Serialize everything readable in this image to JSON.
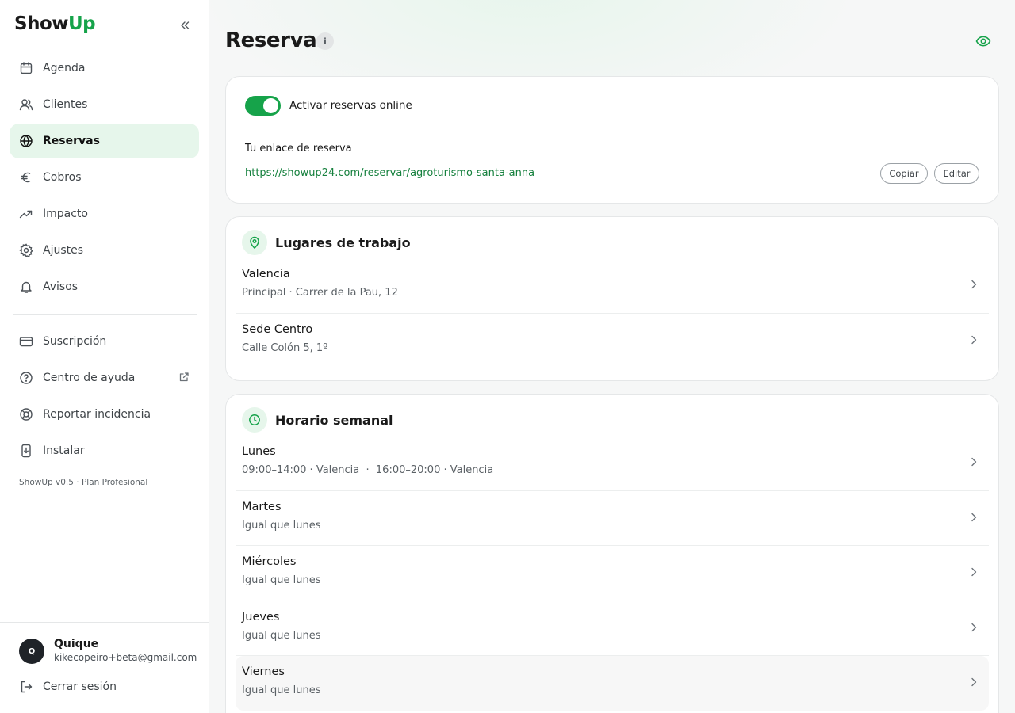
{
  "app": {
    "logo_part1": "Show",
    "logo_part2": "Up",
    "accent_color": "#16a34a"
  },
  "sidebar": {
    "nav": [
      {
        "label": "Agenda",
        "icon": "calendar-icon"
      },
      {
        "label": "Clientes",
        "icon": "users-icon"
      },
      {
        "label": "Reservas",
        "icon": "globe-icon",
        "active": true
      },
      {
        "label": "Cobros",
        "icon": "euro-icon"
      },
      {
        "label": "Impacto",
        "icon": "trending-up-icon"
      },
      {
        "label": "Ajustes",
        "icon": "gear-icon"
      },
      {
        "label": "Avisos",
        "icon": "bell-icon"
      }
    ],
    "secondary": [
      {
        "label": "Suscripción",
        "icon": "credit-card-icon"
      },
      {
        "label": "Centro de ayuda",
        "icon": "help-circle-icon"
      },
      {
        "label": "Reportar incidencia",
        "icon": "lifebuoy-icon"
      },
      {
        "label": "Instalar",
        "icon": "download-icon"
      }
    ],
    "version": "ShowUp v0.5 · Plan Profesional",
    "user": {
      "initial": "Q",
      "name": "Quique",
      "email": "kikecopeiro+beta@gmail.com"
    },
    "logout_label": "Cerrar sesión"
  },
  "main": {
    "title": "Reservas",
    "info_badge": "i",
    "booking": {
      "toggle_label": "Activar reservas online",
      "toggle_on": true,
      "link_title": "Tu enlace de reserva",
      "link_url": "https://showup24.com/reservar/agroturismo-santa-anna",
      "copy_label": "Copiar",
      "edit_label": "Editar"
    },
    "workplaces": {
      "title": "Lugares de trabajo",
      "items": [
        {
          "name": "Valencia",
          "detail": "Principal · Carrer de la Pau, 12"
        },
        {
          "name": "Sede Centro",
          "detail": "Calle Colón 5, 1º"
        }
      ]
    },
    "schedule": {
      "title": "Horario semanal",
      "days": [
        {
          "name": "Lunes",
          "detail": "09:00–14:00 · Valencia  ·  16:00–20:00 · Valencia"
        },
        {
          "name": "Martes",
          "detail": "Igual que lunes"
        },
        {
          "name": "Miércoles",
          "detail": "Igual que lunes"
        },
        {
          "name": "Jueves",
          "detail": "Igual que lunes"
        },
        {
          "name": "Viernes",
          "detail": "Igual que lunes"
        }
      ]
    }
  }
}
